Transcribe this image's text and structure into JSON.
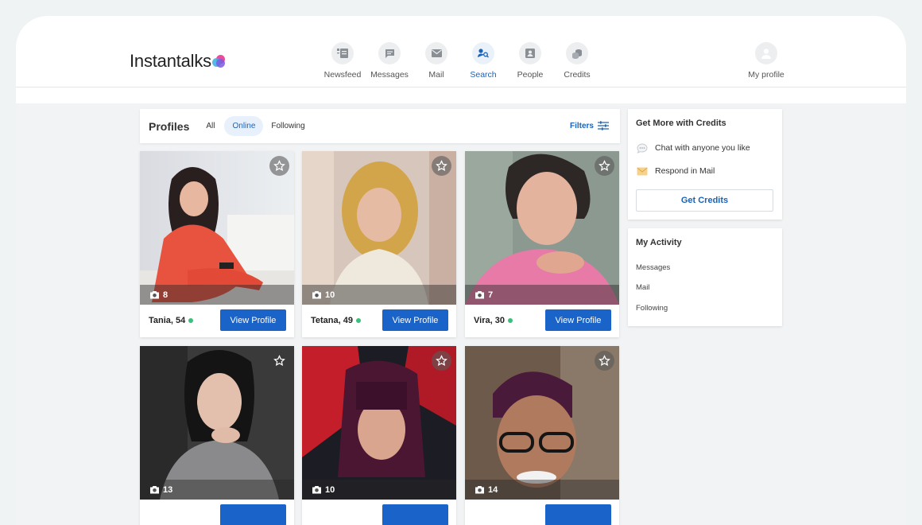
{
  "brand": {
    "name": "Instantalks"
  },
  "nav": [
    {
      "label": "Newsfeed",
      "icon": "newsfeed-icon",
      "active": false
    },
    {
      "label": "Messages",
      "icon": "messages-icon",
      "active": false
    },
    {
      "label": "Mail",
      "icon": "mail-icon",
      "active": false
    },
    {
      "label": "Search",
      "icon": "search-icon",
      "active": true
    },
    {
      "label": "People",
      "icon": "people-icon",
      "active": false
    },
    {
      "label": "Credits",
      "icon": "credits-icon",
      "active": false
    }
  ],
  "profile_nav": {
    "label": "My profile",
    "icon": "avatar-icon"
  },
  "profiles": {
    "title": "Profiles",
    "tabs": [
      "All",
      "Online",
      "Following"
    ],
    "active_tab": "Online",
    "filters_label": "Filters"
  },
  "cards": [
    {
      "name": "Tania, 54",
      "photos": "8",
      "online": true,
      "button": "View Profile"
    },
    {
      "name": "Tetana, 49",
      "photos": "10",
      "online": true,
      "button": "View Profile"
    },
    {
      "name": "Vira, 30",
      "photos": "7",
      "online": true,
      "button": "View Profile"
    },
    {
      "name": "",
      "photos": "13",
      "online": false,
      "button": ""
    },
    {
      "name": "",
      "photos": "10",
      "online": false,
      "button": ""
    },
    {
      "name": "",
      "photos": "14",
      "online": false,
      "button": ""
    }
  ],
  "credits_panel": {
    "title": "Get More with Credits",
    "features": [
      "Chat with anyone you like",
      "Respond in Mail"
    ],
    "button": "Get Credits"
  },
  "activity_panel": {
    "title": "My Activity",
    "items": [
      "Messages",
      "Mail",
      "Following"
    ]
  },
  "colors": {
    "accent": "#1a63c8",
    "online": "#3bbf7a"
  }
}
